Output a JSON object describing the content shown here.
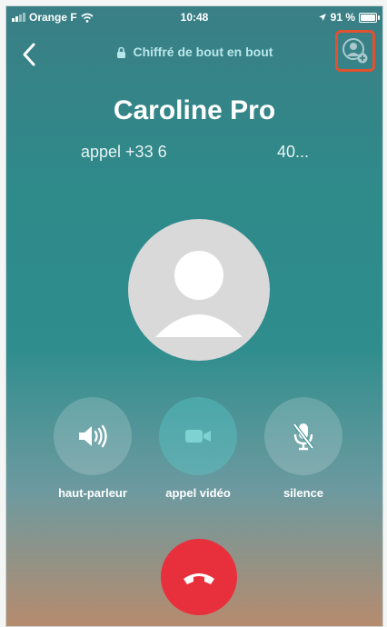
{
  "status": {
    "carrier": "Orange F",
    "time": "10:48",
    "battery": "91 %"
  },
  "header": {
    "e2e_label": "Chiffré de bout en bout"
  },
  "contact": {
    "name": "Caroline Pro",
    "call_prefix": "appel +33 6",
    "call_suffix": "40..."
  },
  "controls": [
    {
      "label": "haut-parleur"
    },
    {
      "label": "appel vidéo"
    },
    {
      "label": "silence"
    }
  ],
  "colors": {
    "highlight": "#e0522f",
    "hangup": "#e8303c"
  }
}
